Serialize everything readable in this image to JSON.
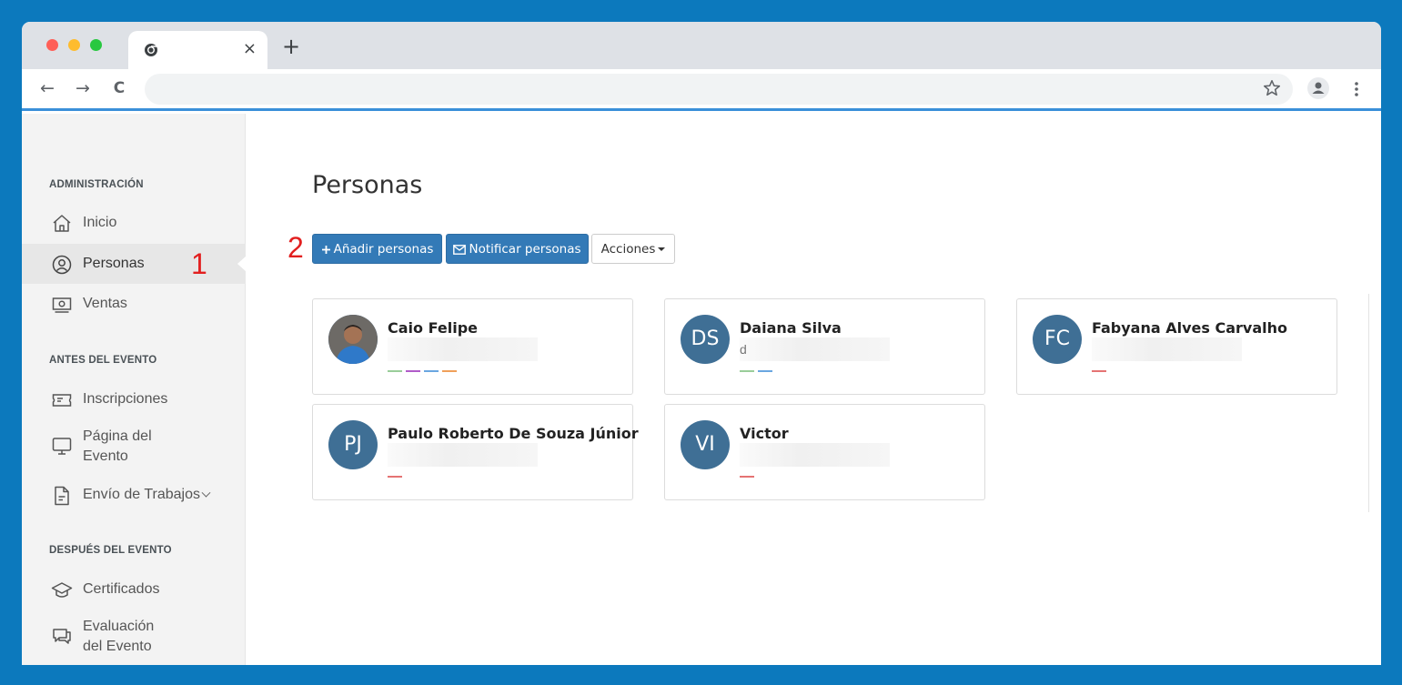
{
  "browser": {
    "tab_close": "×",
    "new_tab": "+",
    "back": "←",
    "forward": "→",
    "reload": "C"
  },
  "sidebar": {
    "sections": [
      {
        "title": "ADMINISTRACIÓN"
      },
      {
        "title": "ANTES DEL EVENTO"
      },
      {
        "title": "DESPUÉS DEL EVENTO"
      }
    ],
    "items": [
      {
        "label": "Inicio",
        "icon": "home-icon"
      },
      {
        "label": "Personas",
        "icon": "user-circle-icon",
        "active": true
      },
      {
        "label": "Ventas",
        "icon": "money-icon"
      },
      {
        "label": "Inscripciones",
        "icon": "ticket-icon"
      },
      {
        "label_line1": "Página del",
        "label_line2": "Evento",
        "icon": "monitor-icon"
      },
      {
        "label": "Envío de Trabajos",
        "icon": "document-icon",
        "has_dropdown": true
      },
      {
        "label": "Certificados",
        "icon": "graduation-cap-icon"
      },
      {
        "label_line1": "Evaluación",
        "label_line2": "del Evento",
        "icon": "chat-icon"
      }
    ]
  },
  "annotations": {
    "one": "1",
    "two": "2"
  },
  "main": {
    "title": "Personas",
    "buttons": {
      "add_label": "Añadir personas",
      "notify_label": "Notificar personas",
      "actions_label": "Acciones"
    }
  },
  "people": [
    {
      "name": "Caio Felipe",
      "initials": "",
      "email": "",
      "has_photo": true,
      "tags": [
        "#9acd9a",
        "#b05cc9",
        "#6aa6e0",
        "#f0a05a"
      ]
    },
    {
      "name": "Daiana Silva",
      "initials": "DS",
      "email": "d",
      "tags": [
        "#9acd9a",
        "#6aa6e0"
      ]
    },
    {
      "name": "Fabyana Alves Carvalho",
      "initials": "FC",
      "email": "",
      "tags": [
        "#e57373"
      ]
    },
    {
      "name": "Paulo Roberto De Souza Júnior",
      "initials": "PJ",
      "email": "",
      "tags": [
        "#e57373"
      ]
    },
    {
      "name": "Victor",
      "initials": "VI",
      "email": "",
      "tags": [
        "#e57373"
      ]
    }
  ],
  "colors": {
    "background": "#0c79bd",
    "primary": "#337ab7",
    "avatar": "#3f6f95",
    "annotation": "#e21f1f"
  }
}
